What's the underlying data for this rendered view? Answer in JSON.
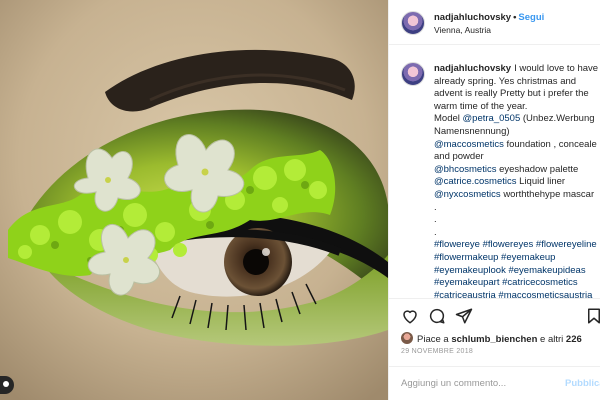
{
  "post": {
    "username": "nadjahluchovsky",
    "separator": "•",
    "follow_label": "Segui",
    "location": "Vienna, Austria"
  },
  "caption": {
    "username": "nadjahluchovsky",
    "lines": [
      "I would love to have",
      "already spring. Yes christmas and",
      "advent is really Pretty but i prefer the",
      "warm time of the year.",
      "Model"
    ],
    "model_handle": "@petra_0505",
    "model_note": "(Unbez.Werbung",
    "model_note_2": "Namensnennung)",
    "credits": [
      {
        "handle": "@maccosmetics",
        "text": "foundation , conceale"
      },
      {
        "handle": "",
        "text": "and powder"
      },
      {
        "handle": "@bhcosmetics",
        "text": "eyeshadow palette"
      },
      {
        "handle": "@catrice.cosmetics",
        "text": "Liquid liner"
      },
      {
        "handle": "@nyxcosmetics",
        "text": "worththehype mascar"
      }
    ],
    "dots": [
      ".",
      ".",
      "."
    ],
    "hashtag_lines": [
      "#flowereye #flowereyes #flowereyeline",
      "#flowermakeup #eyemakeup",
      "#eyemakeuplook #eyemakeupideas",
      "#eyemakeupart #catricecosmetics",
      "#catriceaustria #maccosmeticsaustria"
    ]
  },
  "actions": {
    "icons": [
      "heart-icon",
      "comment-icon",
      "share-icon",
      "bookmark-icon"
    ]
  },
  "likes": {
    "prefix": "Piace a",
    "user": "schlumb_bienchen",
    "middle": "e altri",
    "count": "226"
  },
  "date": "29 NOVEMBRE 2018",
  "comment": {
    "placeholder": "Aggiungi un commento...",
    "post_label": "Pubblica"
  },
  "colors": {
    "link": "#003569",
    "follow": "#3897f0",
    "post_disabled": "#b3dbff",
    "border": "#efefef"
  }
}
